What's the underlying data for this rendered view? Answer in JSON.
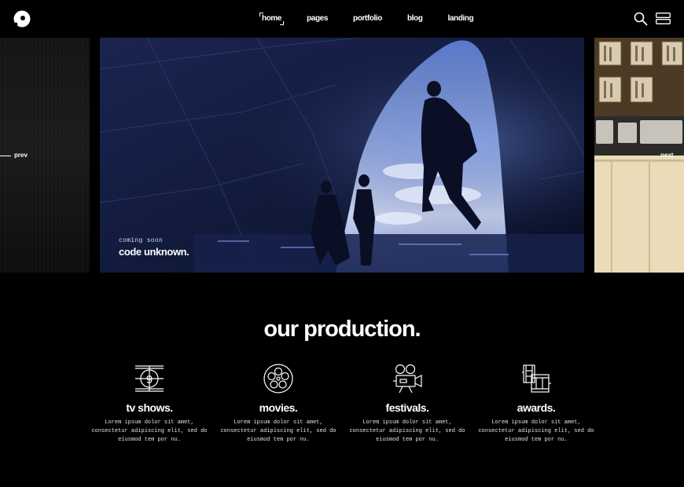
{
  "header": {
    "nav": [
      {
        "label": "home",
        "active": true
      },
      {
        "label": "pages",
        "active": false
      },
      {
        "label": "portfolio",
        "active": false
      },
      {
        "label": "blog",
        "active": false
      },
      {
        "label": "landing",
        "active": false
      }
    ],
    "icons": [
      "logo-icon",
      "search-icon",
      "menu-icon"
    ]
  },
  "slider": {
    "prev_label": "prev",
    "next_label": "next",
    "current": {
      "subtitle": "coming soon",
      "title": "code unknown."
    }
  },
  "production": {
    "title": "our production.",
    "items": [
      {
        "icon": "tv-countdown-icon",
        "title": "tv shows.",
        "text": "Lorem ipsum dolor sit amet, consectetur adipiscing elit, sed do eiusmod tem por nu."
      },
      {
        "icon": "film-reel-icon",
        "title": "movies.",
        "text": "Lorem ipsum dolor sit amet, consectetur adipiscing elit, sed do eiusmod tem por nu."
      },
      {
        "icon": "film-camera-icon",
        "title": "festivals.",
        "text": "Lorem ipsum dolor sit amet, consectetur adipiscing elit, sed do eiusmod tem por nu."
      },
      {
        "icon": "film-strip-icon",
        "title": "awards.",
        "text": "Lorem ipsum dolor sit amet, consectetur adipiscing elit, sed do eiusmod tem por nu."
      }
    ]
  }
}
